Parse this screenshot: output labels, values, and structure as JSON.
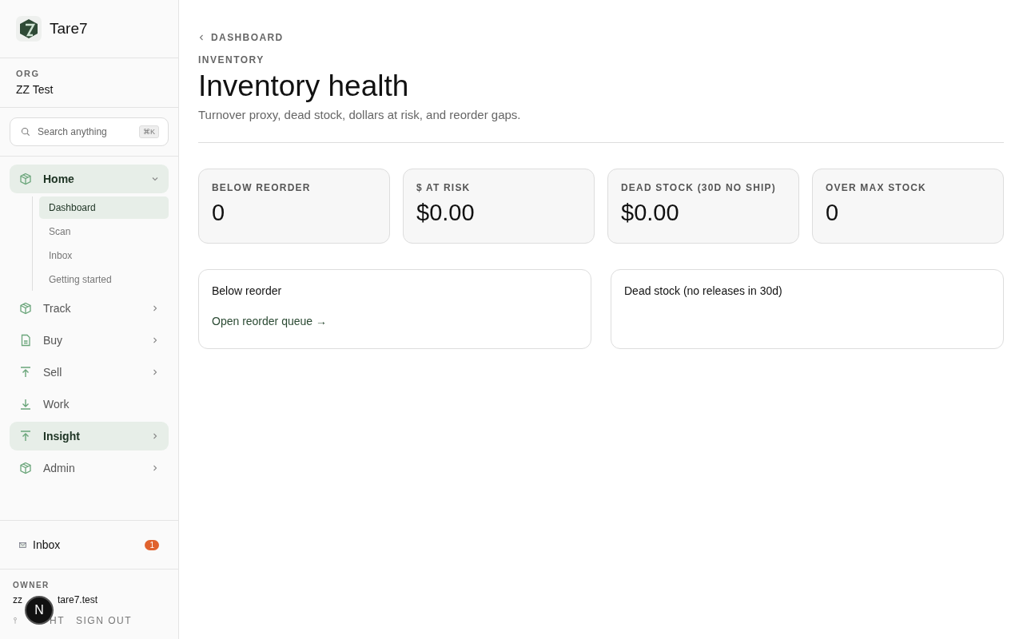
{
  "sidebar": {
    "brand": "Tare7",
    "org": {
      "label": "ORG",
      "name": "ZZ Test"
    },
    "search": {
      "placeholder": "Search anything",
      "shortcut": "⌘K"
    },
    "nav": [
      {
        "label": "Home",
        "kind": "box",
        "selected": true,
        "expanded": true,
        "children": [
          {
            "label": "Dashboard",
            "selected": true
          },
          {
            "label": "Scan",
            "selected": false
          },
          {
            "label": "Inbox",
            "selected": false
          },
          {
            "label": "Getting started",
            "selected": false
          }
        ]
      },
      {
        "label": "Track",
        "kind": "box",
        "selected": false,
        "expanded": false
      },
      {
        "label": "Buy",
        "kind": "doc",
        "selected": false,
        "expanded": false
      },
      {
        "label": "Sell",
        "kind": "up",
        "selected": false,
        "expanded": false
      },
      {
        "label": "Work",
        "kind": "down",
        "selected": false
      },
      {
        "label": "Insight",
        "kind": "up",
        "selected": true,
        "expanded": false
      },
      {
        "label": "Admin",
        "kind": "box",
        "selected": false,
        "expanded": false
      }
    ],
    "inbox": {
      "label": "Inbox",
      "count": "1"
    },
    "footer": {
      "role": "OWNER",
      "email_start": "zz",
      "email_end": "tare7.test",
      "theme": "HT",
      "sign_out": "SIGN OUT"
    }
  },
  "main": {
    "back": "DASHBOARD",
    "eyebrow": "INVENTORY",
    "title": "Inventory health",
    "subtitle": "Turnover proxy, dead stock, dollars at risk, and reorder gaps.",
    "stats": [
      {
        "label": "BELOW REORDER",
        "value": "0"
      },
      {
        "label": "$ AT RISK",
        "value": "$0.00"
      },
      {
        "label": "DEAD STOCK (30D NO SHIP)",
        "value": "$0.00"
      },
      {
        "label": "OVER MAX STOCK",
        "value": "0"
      }
    ],
    "panels": [
      {
        "title": "Below reorder",
        "link": "Open reorder queue →"
      },
      {
        "title": "Dead stock (no releases in 30d)"
      }
    ]
  },
  "dev_badge": "N"
}
